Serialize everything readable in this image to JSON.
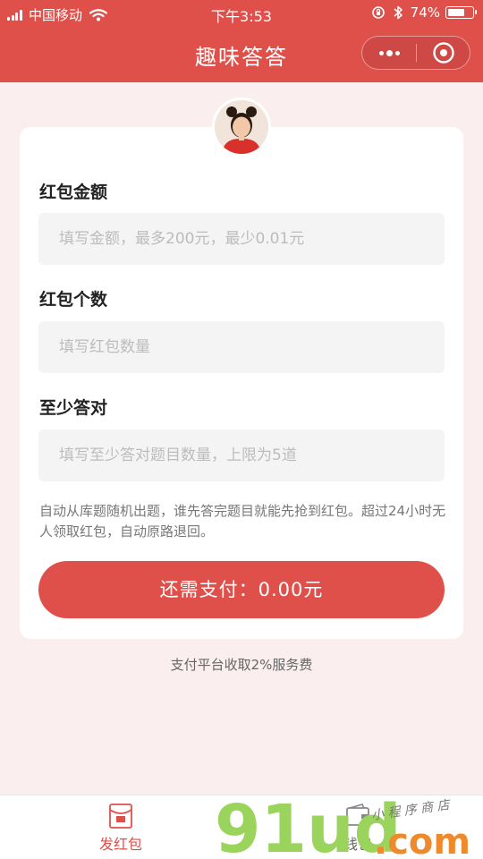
{
  "status_bar": {
    "carrier": "中国移动",
    "time": "下午3:53",
    "battery_percent": "74%",
    "battery_level": 0.74
  },
  "nav": {
    "title": "趣味答答"
  },
  "form": {
    "amount": {
      "label": "红包金额",
      "placeholder": "填写金额，最多200元，最少0.01元"
    },
    "count": {
      "label": "红包个数",
      "placeholder": "填写红包数量"
    },
    "min_correct": {
      "label": "至少答对",
      "placeholder": "填写至少答对题目数量，上限为5道"
    },
    "hint": "自动从库题随机出题，谁先答完题目就能先抢到红包。超过24小时无人领取红包，自动原路退回。",
    "pay_button": "还需支付：0.00元"
  },
  "fee_note": "支付平台收取2%服务费",
  "tab_bar": {
    "tabs": [
      {
        "label": "发红包",
        "icon": "red-envelope-icon",
        "active": true
      },
      {
        "label": "钱包",
        "icon": "wallet-icon",
        "active": false
      }
    ]
  },
  "watermark": {
    "logo_text": "91ud.com",
    "subtitle": "小程序商店"
  },
  "colors": {
    "brand": "#e0504b",
    "background": "#fbeeee"
  }
}
